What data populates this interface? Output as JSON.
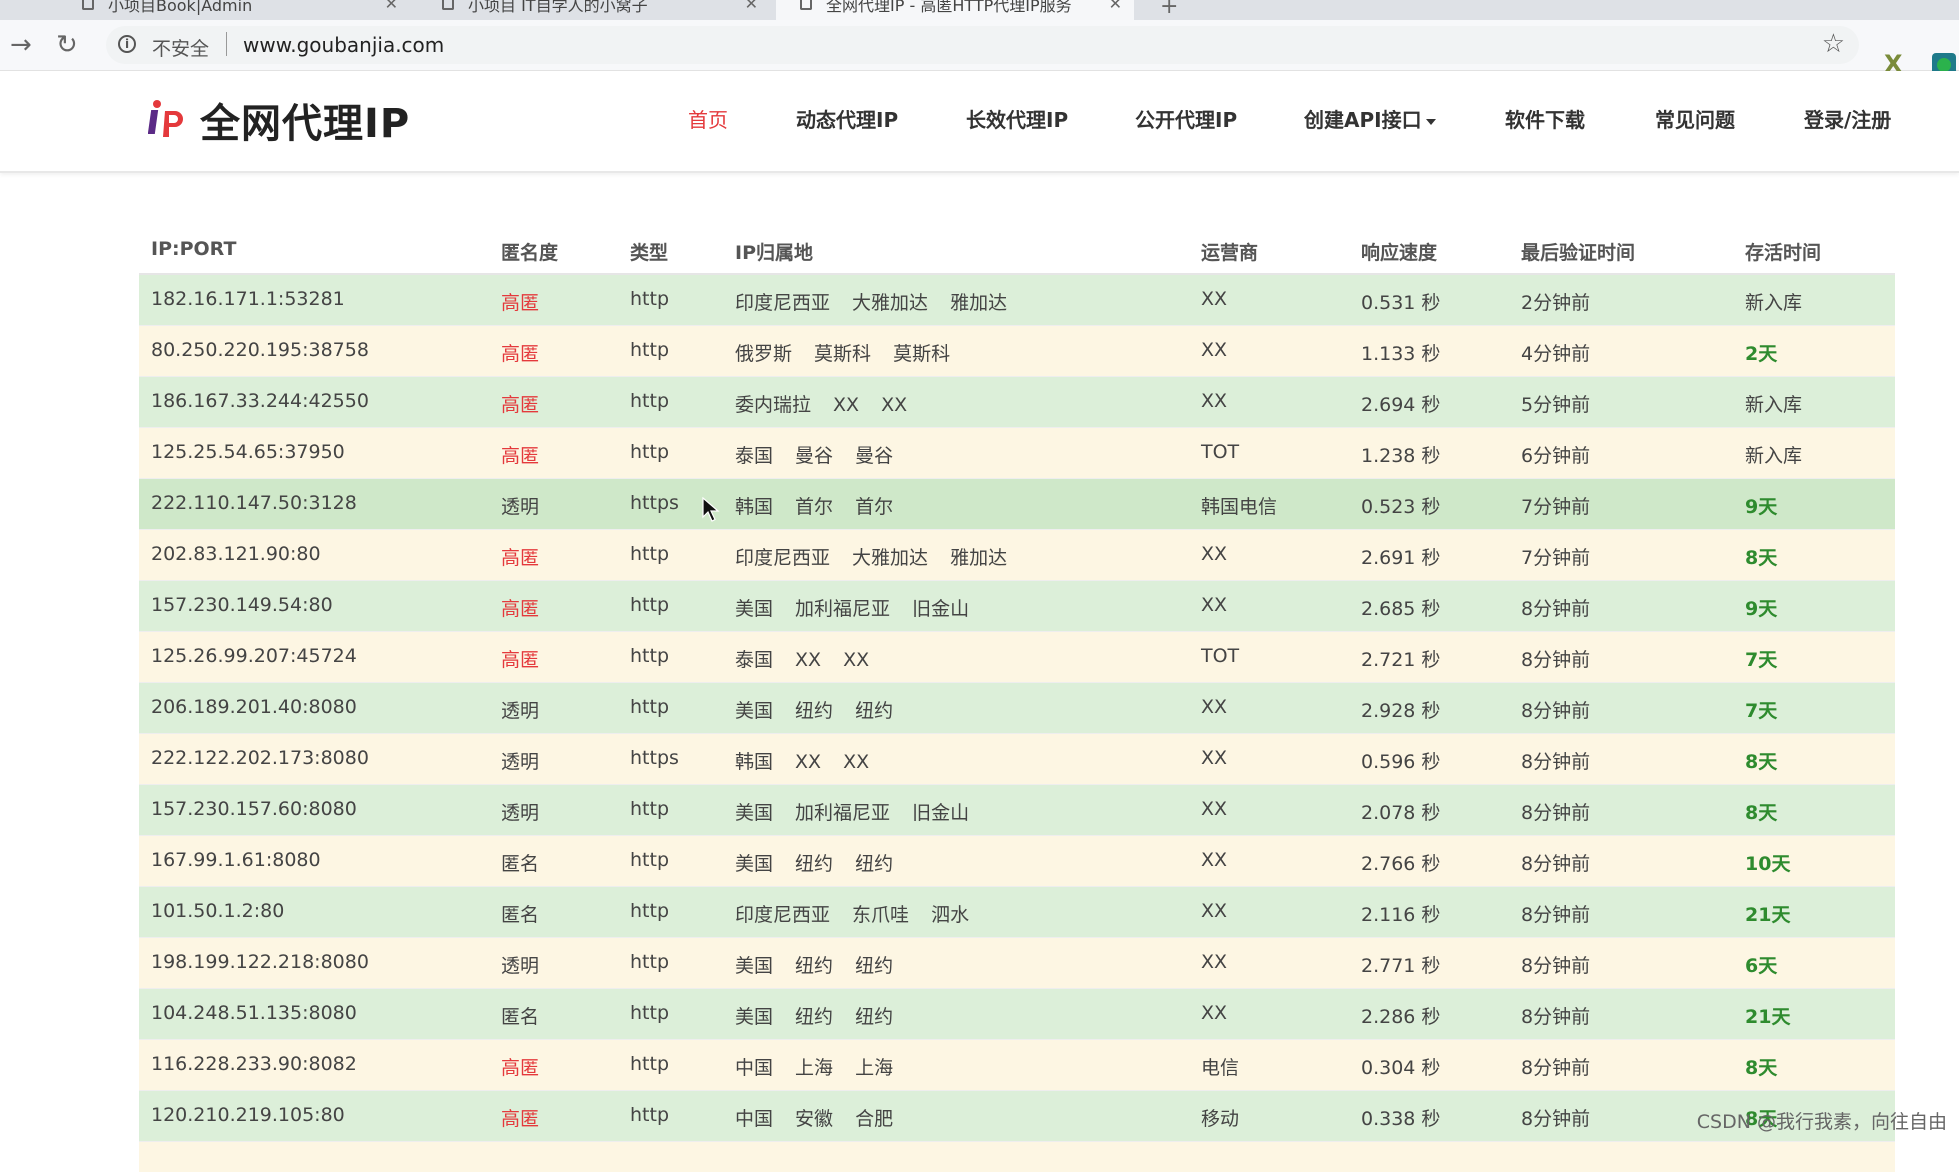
{
  "browser": {
    "tabs": [
      {
        "title": "小项目Book|Admin"
      },
      {
        "title": "小项目 IT自学人的小窝子"
      },
      {
        "title": "全网代理IP - 高匿HTTP代理IP服务"
      }
    ],
    "omnibox": {
      "security_label": "不安全",
      "url": "www.goubanjia.com"
    },
    "icons": {
      "back": "back-arrow-icon",
      "reload": "reload-icon",
      "info": "info-icon",
      "star": "bookmark-star-icon"
    }
  },
  "site": {
    "logo_text": "全网代理IP",
    "nav": [
      {
        "label": "首页",
        "active": true
      },
      {
        "label": "动态代理IP"
      },
      {
        "label": "长效代理IP"
      },
      {
        "label": "公开代理IP"
      },
      {
        "label": "创建API接口"
      },
      {
        "label": "软件下载"
      },
      {
        "label": "常见问题"
      },
      {
        "label": "登录/注册"
      }
    ],
    "accent_color": "#e4393c",
    "life_color": "#2e8b2e"
  },
  "table": {
    "headers": [
      "IP:PORT",
      "匿名度",
      "类型",
      "IP归属地",
      "运营商",
      "响应速度",
      "最后验证时间",
      "存活时间"
    ],
    "rows": [
      {
        "ip": "182.16.171.1:53281",
        "anon": "高匿",
        "type": "http",
        "loc": "印度尼西亚 大雅加达 雅加达",
        "isp": "XX",
        "speed": "0.531 秒",
        "verify": "2分钟前",
        "life": "新入库"
      },
      {
        "ip": "80.250.220.195:38758",
        "anon": "高匿",
        "type": "http",
        "loc": "俄罗斯 莫斯科 莫斯科",
        "isp": "XX",
        "speed": "1.133 秒",
        "verify": "4分钟前",
        "life": "2天"
      },
      {
        "ip": "186.167.33.244:42550",
        "anon": "高匿",
        "type": "http",
        "loc": "委内瑞拉 XX XX",
        "isp": "XX",
        "speed": "2.694 秒",
        "verify": "5分钟前",
        "life": "新入库"
      },
      {
        "ip": "125.25.54.65:37950",
        "anon": "高匿",
        "type": "http",
        "loc": "泰国 曼谷 曼谷",
        "isp": "TOT",
        "speed": "1.238 秒",
        "verify": "6分钟前",
        "life": "新入库"
      },
      {
        "ip": "222.110.147.50:3128",
        "anon": "透明",
        "type": "https",
        "loc": "韩国 首尔 首尔",
        "isp": "韩国电信",
        "speed": "0.523 秒",
        "verify": "7分钟前",
        "life": "9天"
      },
      {
        "ip": "202.83.121.90:80",
        "anon": "高匿",
        "type": "http",
        "loc": "印度尼西亚 大雅加达 雅加达",
        "isp": "XX",
        "speed": "2.691 秒",
        "verify": "7分钟前",
        "life": "8天"
      },
      {
        "ip": "157.230.149.54:80",
        "anon": "高匿",
        "type": "http",
        "loc": "美国 加利福尼亚 旧金山",
        "isp": "XX",
        "speed": "2.685 秒",
        "verify": "8分钟前",
        "life": "9天"
      },
      {
        "ip": "125.26.99.207:45724",
        "anon": "高匿",
        "type": "http",
        "loc": "泰国 XX XX",
        "isp": "TOT",
        "speed": "2.721 秒",
        "verify": "8分钟前",
        "life": "7天"
      },
      {
        "ip": "206.189.201.40:8080",
        "anon": "透明",
        "type": "http",
        "loc": "美国 纽约 纽约",
        "isp": "XX",
        "speed": "2.928 秒",
        "verify": "8分钟前",
        "life": "7天"
      },
      {
        "ip": "222.122.202.173:8080",
        "anon": "透明",
        "type": "https",
        "loc": "韩国 XX XX",
        "isp": "XX",
        "speed": "0.596 秒",
        "verify": "8分钟前",
        "life": "8天"
      },
      {
        "ip": "157.230.157.60:8080",
        "anon": "透明",
        "type": "http",
        "loc": "美国 加利福尼亚 旧金山",
        "isp": "XX",
        "speed": "2.078 秒",
        "verify": "8分钟前",
        "life": "8天"
      },
      {
        "ip": "167.99.1.61:8080",
        "anon": "匿名",
        "type": "http",
        "loc": "美国 纽约 纽约",
        "isp": "XX",
        "speed": "2.766 秒",
        "verify": "8分钟前",
        "life": "10天"
      },
      {
        "ip": "101.50.1.2:80",
        "anon": "匿名",
        "type": "http",
        "loc": "印度尼西亚 东爪哇 泗水",
        "isp": "XX",
        "speed": "2.116 秒",
        "verify": "8分钟前",
        "life": "21天"
      },
      {
        "ip": "198.199.122.218:8080",
        "anon": "透明",
        "type": "http",
        "loc": "美国 纽约 纽约",
        "isp": "XX",
        "speed": "2.771 秒",
        "verify": "8分钟前",
        "life": "6天"
      },
      {
        "ip": "104.248.51.135:8080",
        "anon": "匿名",
        "type": "http",
        "loc": "美国 纽约 纽约",
        "isp": "XX",
        "speed": "2.286 秒",
        "verify": "8分钟前",
        "life": "21天"
      },
      {
        "ip": "116.228.233.90:8082",
        "anon": "高匿",
        "type": "http",
        "loc": "中国 上海 上海",
        "isp": "电信",
        "speed": "0.304 秒",
        "verify": "8分钟前",
        "life": "8天"
      },
      {
        "ip": "120.210.219.105:80",
        "anon": "高匿",
        "type": "http",
        "loc": "中国 安徽 合肥",
        "isp": "移动",
        "speed": "0.338 秒",
        "verify": "8分钟前",
        "life": "8天"
      }
    ]
  },
  "watermark": "CSDN @我行我素，向往自由"
}
